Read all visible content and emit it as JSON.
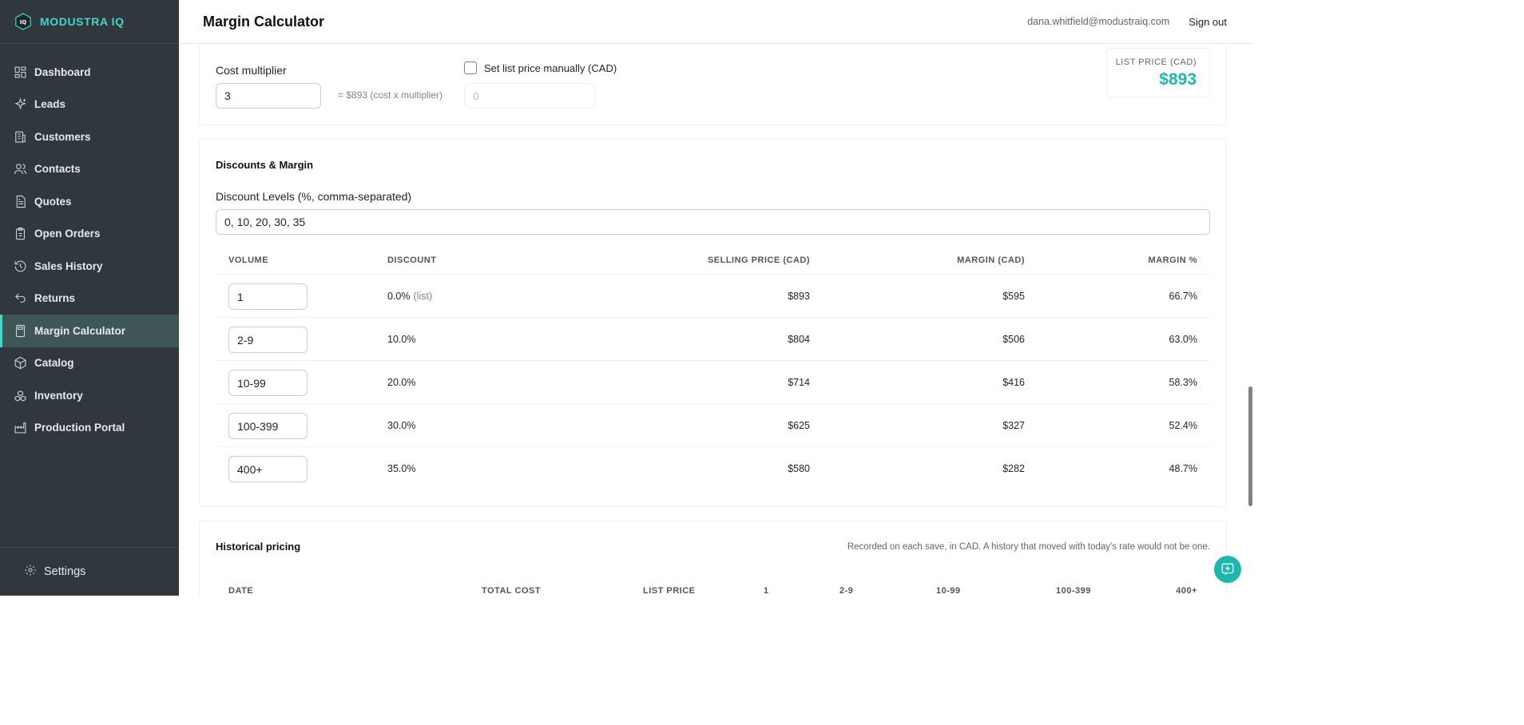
{
  "brand": {
    "name": "MODUSTRA IQ",
    "logo_text": "IQ"
  },
  "sidebar": {
    "items": [
      {
        "label": "Dashboard",
        "icon": "dashboard-icon"
      },
      {
        "label": "Leads",
        "icon": "sparkle-icon"
      },
      {
        "label": "Customers",
        "icon": "building-icon"
      },
      {
        "label": "Contacts",
        "icon": "users-icon"
      },
      {
        "label": "Quotes",
        "icon": "document-icon"
      },
      {
        "label": "Open Orders",
        "icon": "clipboard-icon"
      },
      {
        "label": "Sales History",
        "icon": "history-icon"
      },
      {
        "label": "Returns",
        "icon": "undo-icon"
      },
      {
        "label": "Margin Calculator",
        "icon": "calculator-icon",
        "active": true
      },
      {
        "label": "Catalog",
        "icon": "box-icon"
      },
      {
        "label": "Inventory",
        "icon": "boxes-icon"
      },
      {
        "label": "Production Portal",
        "icon": "factory-icon"
      }
    ],
    "footer": {
      "label": "Settings",
      "icon": "gear-icon"
    }
  },
  "header": {
    "title": "Margin Calculator",
    "user_email": "dana.whitfield@modustraiq.com",
    "signout_label": "Sign out"
  },
  "pricing": {
    "cost_multiplier_label": "Cost multiplier",
    "cost_multiplier_value": "3",
    "computed_hint": "= $893 (cost x multiplier)",
    "manual_checkbox_label": "Set list price manually (CAD)",
    "manual_checked": false,
    "manual_price_placeholder": "0",
    "list_price_label": "LIST PRICE (CAD)",
    "list_price_value": "$893"
  },
  "discounts": {
    "section_title": "Discounts & Margin",
    "levels_label": "Discount Levels (%, comma-separated)",
    "levels_value": "0, 10, 20, 30, 35",
    "columns": [
      "VOLUME",
      "DISCOUNT",
      "SELLING PRICE (CAD)",
      "MARGIN (CAD)",
      "MARGIN %"
    ],
    "rows": [
      {
        "volume": "1",
        "discount": "0.0%",
        "note": "(list)",
        "selling": "$893",
        "margin": "$595",
        "margin_pct": "66.7%"
      },
      {
        "volume": "2-9",
        "discount": "10.0%",
        "note": "",
        "selling": "$804",
        "margin": "$506",
        "margin_pct": "63.0%"
      },
      {
        "volume": "10-99",
        "discount": "20.0%",
        "note": "",
        "selling": "$714",
        "margin": "$416",
        "margin_pct": "58.3%"
      },
      {
        "volume": "100-399",
        "discount": "30.0%",
        "note": "",
        "selling": "$625",
        "margin": "$327",
        "margin_pct": "52.4%"
      },
      {
        "volume": "400+",
        "discount": "35.0%",
        "note": "",
        "selling": "$580",
        "margin": "$282",
        "margin_pct": "48.7%"
      }
    ]
  },
  "history": {
    "section_title": "Historical pricing",
    "note": "Recorded on each save, in CAD. A history that moved with today's rate would not be one.",
    "columns": [
      "DATE",
      "TOTAL COST",
      "LIST PRICE",
      "1",
      "2-9",
      "10-99",
      "100-399",
      "400+"
    ]
  },
  "chat": {
    "icon": "chat-plus-icon"
  }
}
